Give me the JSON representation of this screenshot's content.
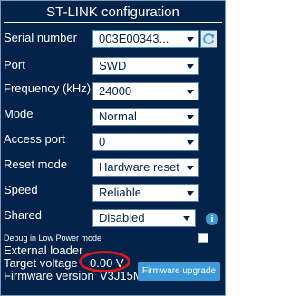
{
  "title": "ST-LINK configuration",
  "fields": {
    "serial_number": {
      "label": "Serial number",
      "value": "003E00343..."
    },
    "port": {
      "label": "Port",
      "value": "SWD"
    },
    "frequency": {
      "label": "Frequency (kHz)",
      "value": "24000"
    },
    "mode": {
      "label": "Mode",
      "value": "Normal"
    },
    "access_port": {
      "label": "Access port",
      "value": "0"
    },
    "reset_mode": {
      "label": "Reset mode",
      "value": "Hardware reset"
    },
    "speed": {
      "label": "Speed",
      "value": "Reliable"
    },
    "shared": {
      "label": "Shared",
      "value": "Disabled"
    }
  },
  "debug_low_power": {
    "label": "Debug in Low Power mode",
    "checked": false
  },
  "external_loader": {
    "label": "External loader"
  },
  "target_voltage": {
    "label": "Target voltage",
    "value": "0.00 V"
  },
  "firmware_version": {
    "label": "Firmware version",
    "value": "V3J15M6"
  },
  "firmware_upgrade_button": "Firmware upgrade",
  "colors": {
    "panel_bg": "#03234b",
    "accent": "#3d9ad9",
    "highlight_ring": "#e01818"
  },
  "icons": {
    "refresh": "refresh-icon",
    "info": "info-icon",
    "dropdown": "chevron-down-icon"
  }
}
